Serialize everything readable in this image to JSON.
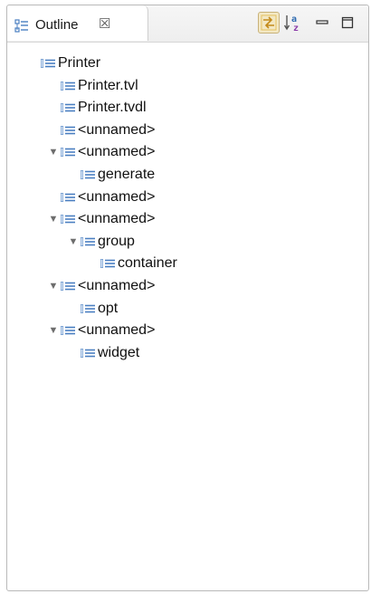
{
  "view": {
    "tab_label": "Outline",
    "tab_close_glyph": "☒",
    "toolbar": {
      "link_icon": "link-with-editor-icon",
      "sort_icon": "sort-alphabetically-icon",
      "minimize_icon": "minimize-icon",
      "maximize_icon": "maximize-icon"
    }
  },
  "tree": {
    "nodes": [
      {
        "label": "Printer",
        "depth": 0,
        "expanded": null
      },
      {
        "label": "Printer.tvl",
        "depth": 1,
        "expanded": null
      },
      {
        "label": "Printer.tvdl",
        "depth": 1,
        "expanded": null
      },
      {
        "label": "<unnamed>",
        "depth": 1,
        "expanded": null
      },
      {
        "label": "<unnamed>",
        "depth": 1,
        "expanded": true
      },
      {
        "label": "generate",
        "depth": 2,
        "expanded": null
      },
      {
        "label": "<unnamed>",
        "depth": 1,
        "expanded": null
      },
      {
        "label": "<unnamed>",
        "depth": 1,
        "expanded": true
      },
      {
        "label": "group",
        "depth": 2,
        "expanded": true
      },
      {
        "label": "container",
        "depth": 3,
        "expanded": null
      },
      {
        "label": "<unnamed>",
        "depth": 1,
        "expanded": true
      },
      {
        "label": "opt",
        "depth": 2,
        "expanded": null
      },
      {
        "label": "<unnamed>",
        "depth": 1,
        "expanded": true
      },
      {
        "label": "widget",
        "depth": 2,
        "expanded": null
      }
    ]
  },
  "colors": {
    "node_icon_blue": "#4a7fc1",
    "link_active_bg": "#f3e8c4"
  }
}
